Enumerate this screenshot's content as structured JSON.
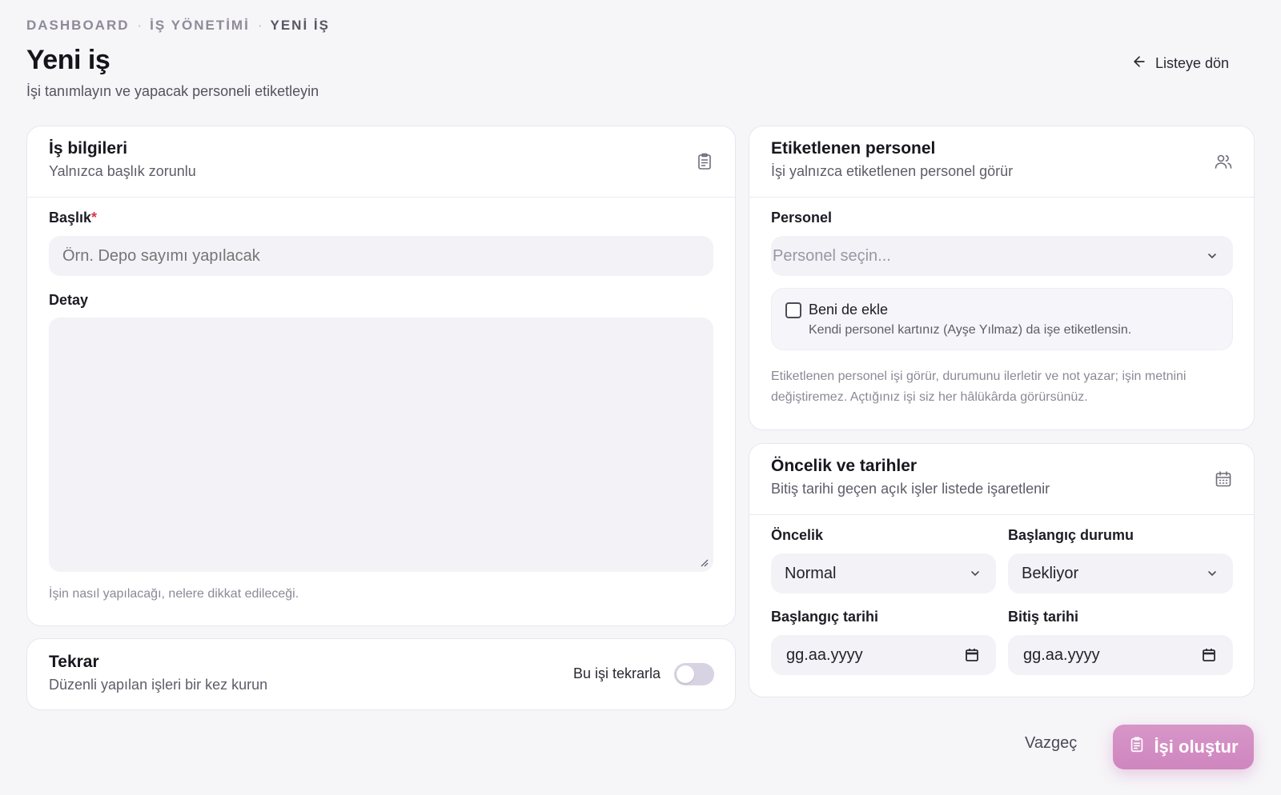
{
  "breadcrumb": {
    "items": [
      "DASHBOARD",
      "İŞ YÖNETİMİ",
      "YENİ İŞ"
    ],
    "separator": "·"
  },
  "page": {
    "title": "Yeni iş",
    "subtitle": "İşi tanımlayın ve yapacak personeli etiketleyin",
    "back_label": "Listeye dön"
  },
  "job_info": {
    "title": "İş bilgileri",
    "subtitle": "Yalnızca başlık zorunlu",
    "icon": "clipboard-icon",
    "title_label": "Başlık",
    "required_mark": "*",
    "title_placeholder": "Örn. Depo sayımı yapılacak",
    "title_value": "",
    "detail_label": "Detay",
    "detail_value": "",
    "detail_hint": "İşin nasıl yapılacağı, nelere dikkat edileceği."
  },
  "repeat": {
    "title": "Tekrar",
    "subtitle": "Düzenli yapılan işleri bir kez kurun",
    "toggle_label": "Bu işi tekrarla",
    "toggle_on": false
  },
  "tagged": {
    "title": "Etiketlenen personel",
    "subtitle": "İşi yalnızca etiketlenen personel görür",
    "icon": "users-icon",
    "personnel_label": "Personel",
    "personnel_placeholder": "Personel seçin...",
    "add_me_label": "Beni de ekle",
    "add_me_hint": "Kendi personel kartınız (Ayşe Yılmaz) da işe etiketlensin.",
    "add_me_checked": false,
    "note_line1": "Etiketlenen personel işi görür, durumunu ilerletir ve not yazar; işin metnini",
    "note_line2": "değiştiremez. Açtığınız işi siz her hâlükârda görürsünüz."
  },
  "priority": {
    "title": "Öncelik ve tarihler",
    "subtitle": "Bitiş tarihi geçen açık işler listede işaretlenir",
    "icon": "calendar-icon",
    "priority_label": "Öncelik",
    "priority_value": "Normal",
    "status_label": "Başlangıç durumu",
    "status_value": "Bekliyor",
    "start_label": "Başlangıç tarihi",
    "start_placeholder": "gg.aa.yyyy",
    "end_label": "Bitiş tarihi",
    "end_placeholder": "gg.aa.yyyy"
  },
  "actions": {
    "cancel_label": "Vazgeç",
    "submit_label": "İşi oluştur"
  },
  "colors": {
    "accent": "#d08ac2",
    "required": "#d8364d",
    "background": "#f6f5f8"
  }
}
